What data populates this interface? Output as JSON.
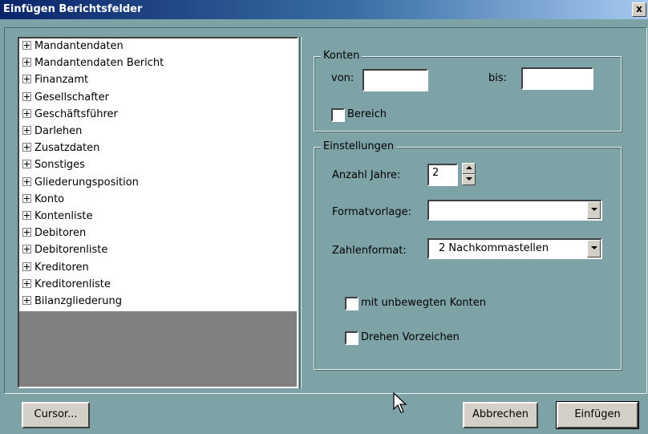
{
  "window": {
    "title": "Einfügen Berichtsfelder",
    "close_label": "x"
  },
  "tree": {
    "items": [
      "Mandantendaten",
      "Mandantendaten Bericht",
      "Finanzamt",
      "Gesellschafter",
      "Geschäftsführer",
      "Darlehen",
      "Zusatzdaten",
      "Sonstiges",
      "Gliederungsposition",
      "Konto",
      "Kontenliste",
      "Debitoren",
      "Debitorenliste",
      "Kreditoren",
      "Kreditorenliste",
      "Bilanzgliederung"
    ]
  },
  "konten": {
    "legend": "Konten",
    "von_label": "von:",
    "von_value": "",
    "bis_label": "bis:",
    "bis_value": "",
    "bereich_label": "Bereich",
    "bereich_checked": false
  },
  "einstellungen": {
    "legend": "Einstellungen",
    "anzahl_label": "Anzahl Jahre:",
    "anzahl_value": "2",
    "format_label": "Formatvorlage:",
    "format_value": "",
    "zahlen_label": "Zahlenformat:",
    "zahlen_value": "2 Nachkommastellen",
    "unbewegt_label": "mit unbewegten Konten",
    "unbewegt_checked": false,
    "drehen_label": "Drehen Vorzeichen",
    "drehen_checked": false
  },
  "buttons": {
    "cursor": "Cursor...",
    "abbrechen": "Abbrechen",
    "einfuegen": "Einfügen"
  },
  "colors": {
    "background": "#7ea3a6",
    "titlebar": "#0a246a"
  }
}
